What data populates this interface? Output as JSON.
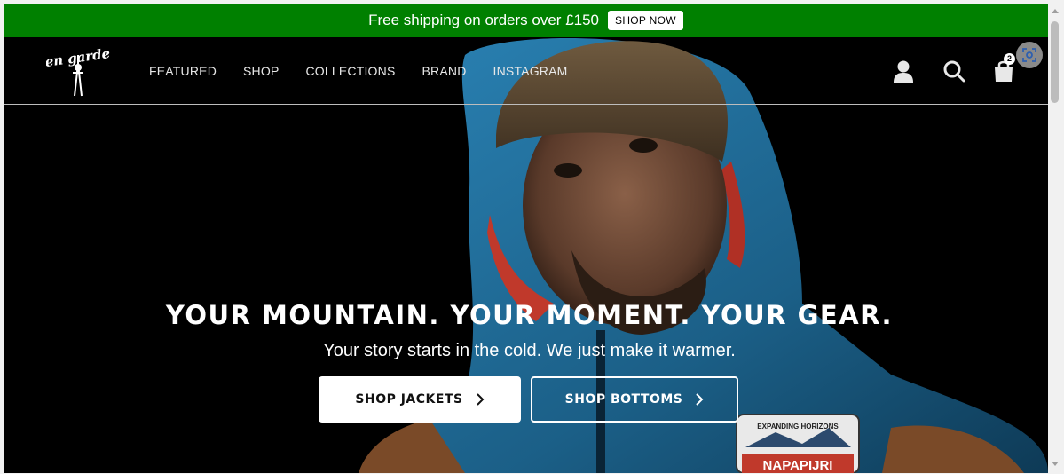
{
  "announcement": {
    "text": "Free shipping on orders over £150",
    "button": "SHOP NOW"
  },
  "header": {
    "logo_text": "en garde",
    "nav": [
      "FEATURED",
      "SHOP",
      "COLLECTIONS",
      "BRAND",
      "INSTAGRAM"
    ],
    "icons": [
      "account-icon",
      "search-icon",
      "cart-icon"
    ],
    "cart_count": "2"
  },
  "hero": {
    "title": "YOUR MOUNTAIN. YOUR MOMENT. YOUR GEAR.",
    "subtitle": "Your story starts in the cold. We just make it warmer.",
    "buttons": [
      "SHOP JACKETS",
      "SHOP BOTTOMS"
    ],
    "patch_top": "EXPANDING HORIZONS",
    "patch_brand": "NAPAPIJRI"
  },
  "colors": {
    "announcement_bg": "#008000",
    "jacket": "#1f6e9a",
    "hero_bg": "#000000"
  }
}
